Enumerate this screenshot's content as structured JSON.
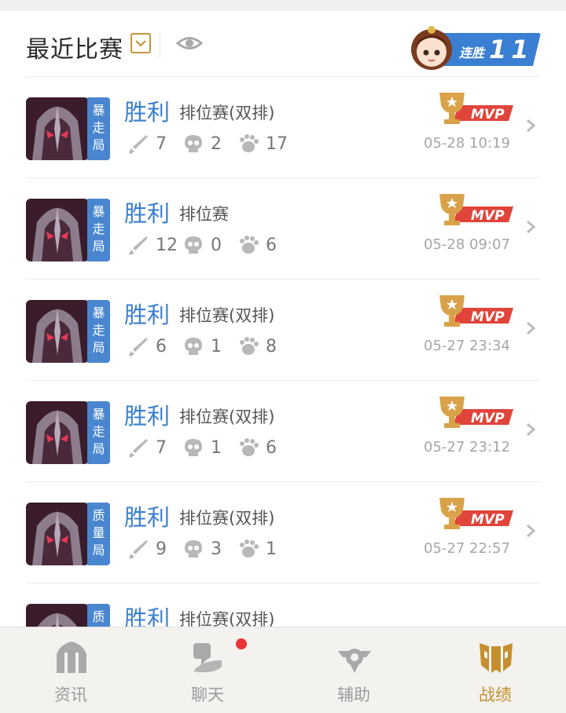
{
  "header": {
    "title": "最近比赛",
    "streak_label": "连胜",
    "streak_count": "11"
  },
  "matches": [
    {
      "mode": "暴走局",
      "result": "胜利",
      "type": "排位赛(双排)",
      "kills": "7",
      "deaths": "2",
      "assists": "17",
      "time": "05-28 10:19",
      "mvp": "MVP"
    },
    {
      "mode": "暴走局",
      "result": "胜利",
      "type": "排位赛",
      "kills": "12",
      "deaths": "0",
      "assists": "6",
      "time": "05-28 09:07",
      "mvp": "MVP"
    },
    {
      "mode": "暴走局",
      "result": "胜利",
      "type": "排位赛(双排)",
      "kills": "6",
      "deaths": "1",
      "assists": "8",
      "time": "05-27 23:34",
      "mvp": "MVP"
    },
    {
      "mode": "暴走局",
      "result": "胜利",
      "type": "排位赛(双排)",
      "kills": "7",
      "deaths": "1",
      "assists": "6",
      "time": "05-27 23:12",
      "mvp": "MVP"
    },
    {
      "mode": "质量局",
      "result": "胜利",
      "type": "排位赛(双排)",
      "kills": "9",
      "deaths": "3",
      "assists": "1",
      "time": "05-27 22:57",
      "mvp": "MVP"
    },
    {
      "mode": "质",
      "result": "胜利",
      "type": "排位赛(双排)"
    }
  ],
  "tabs": [
    {
      "label": "资讯",
      "icon": "news-icon",
      "active": false,
      "badge": false
    },
    {
      "label": "聊天",
      "icon": "chat-icon",
      "active": false,
      "badge": true
    },
    {
      "label": "辅助",
      "icon": "assist-icon",
      "active": false,
      "badge": false
    },
    {
      "label": "战绩",
      "icon": "record-icon",
      "active": true,
      "badge": false
    }
  ],
  "colors": {
    "accent_blue": "#3a7fcf",
    "tag_blue": "#4a86cf",
    "gold": "#c58f2e",
    "mvp_red": "#e0443a",
    "badge_red": "#ea3434"
  }
}
